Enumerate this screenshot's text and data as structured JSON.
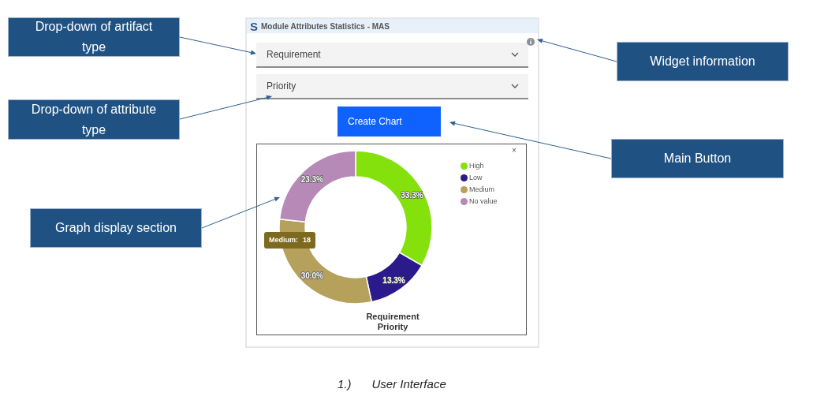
{
  "callouts": [
    {
      "text": "Drop-down of artifact type"
    },
    {
      "text": "Drop-down of attribute type"
    },
    {
      "text": "Graph display section"
    },
    {
      "text": "Widget information"
    },
    {
      "text": "Main Button"
    }
  ],
  "widget": {
    "logo": "S",
    "title": "Module Attributes Statistics - MAS",
    "dropdowns": [
      {
        "value": "Requirement"
      },
      {
        "value": "Priority"
      }
    ],
    "button": "Create Chart",
    "chart": {
      "close": "×",
      "tooltip": {
        "label": "Medium:",
        "value": "18"
      },
      "chart_data": {
        "type": "donut",
        "title": "Requirement Priority",
        "categories": [
          "High",
          "Low",
          "Medium",
          "No value"
        ],
        "colors": [
          "#84e10b",
          "#2a1a8c",
          "#b5a05c",
          "#b689b6"
        ],
        "series": [
          {
            "values": [
              33.3,
              13.3,
              30.0,
              23.3
            ]
          }
        ],
        "value_labels": [
          "33.3%",
          "13.3%",
          "30.0%",
          "23.3%"
        ]
      }
    }
  },
  "caption": {
    "number": "1.)",
    "text": "User Interface"
  }
}
